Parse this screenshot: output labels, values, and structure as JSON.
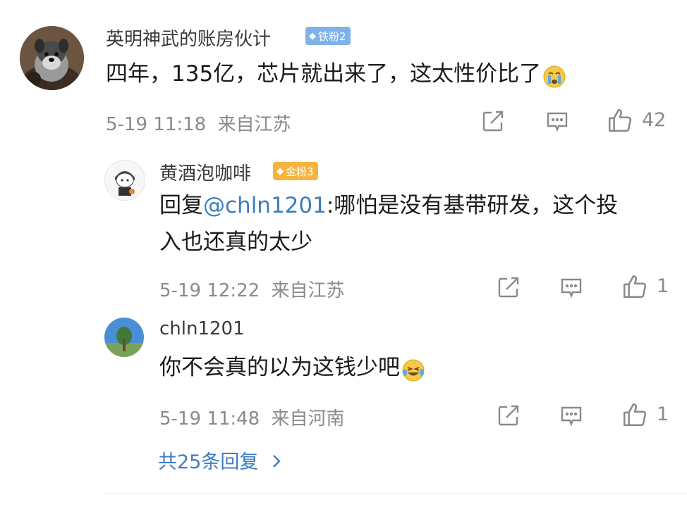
{
  "comments": [
    {
      "username": "英明神武的账房伙计",
      "badge": "铁粉2",
      "badge_color": "#7fb1ea",
      "text": "四年，135亿，芯片就出来了，这太性价比了",
      "emoji": "crying-face-icon",
      "date": "5-19 11:18",
      "location": "来自江苏",
      "likes": "42"
    }
  ],
  "replies": [
    {
      "username": "黄酒泡咖啡",
      "badge": "金粉3",
      "badge_color": "#f5b53d",
      "reply_prefix": "回复",
      "mention": "@chln1201",
      "text_line1": ":哪怕是没有基带研发，这个投",
      "text_line2": "入也还真的太少",
      "date": "5-19 12:22",
      "location": "来自江苏",
      "likes": "1"
    },
    {
      "username": "chln1201",
      "text": "你不会真的以为这钱少吧",
      "emoji": "laughing-tears-icon",
      "date": "5-19 11:48",
      "location": "来自河南",
      "likes": "1"
    }
  ],
  "more_replies": "共25条回复",
  "colors": {
    "link": "#3e7cc0",
    "meta": "#8a8a8a",
    "iron_badge": "#7fb1ea",
    "gold_badge": "#f5b53d"
  }
}
